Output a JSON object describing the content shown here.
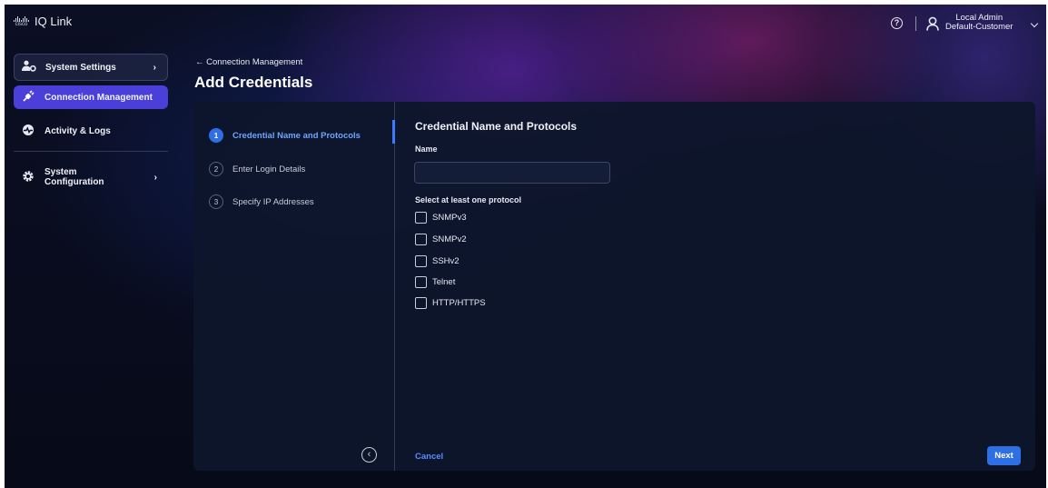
{
  "brand": {
    "logo_text": "cisco",
    "app_name": "IQ Link"
  },
  "topbar": {
    "help_icon": "question-circle-icon",
    "user_name": "Local Admin",
    "user_org": "Default-Customer"
  },
  "sidebar": {
    "items": [
      {
        "label": "System Settings",
        "icon": "users-gear-icon",
        "active": false,
        "has_chevron": true
      },
      {
        "label": "Connection Management",
        "icon": "plug-icon",
        "active": true,
        "has_chevron": false
      },
      {
        "label": "Activity & Logs",
        "icon": "activity-icon",
        "active": false,
        "has_chevron": false
      },
      {
        "label_line1": "System",
        "label_line2": "Configuration",
        "icon": "gear-icon",
        "active": false,
        "has_chevron": true
      }
    ],
    "chevron_glyph": "›"
  },
  "header": {
    "back_link": "← Connection Management",
    "title": "Add Credentials"
  },
  "steps": [
    {
      "num": "1",
      "label": "Credential Name and Protocols",
      "active": true
    },
    {
      "num": "2",
      "label": "Enter Login Details",
      "active": false
    },
    {
      "num": "3",
      "label": "Specify IP Addresses",
      "active": false
    }
  ],
  "form": {
    "section_title": "Credential Name and Protocols",
    "name_label": "Name",
    "name_value": "",
    "protocol_label": "Select at least one protocol",
    "protocols": [
      "SNMPv3",
      "SNMPv2",
      "SSHv2",
      "Telnet",
      "HTTP/HTTPS"
    ]
  },
  "footer": {
    "cancel_label": "Cancel",
    "next_label": "Next"
  },
  "colors": {
    "accent": "#2f6fe6",
    "nav_active": "#4b3fd9",
    "link": "#5a8dff"
  }
}
